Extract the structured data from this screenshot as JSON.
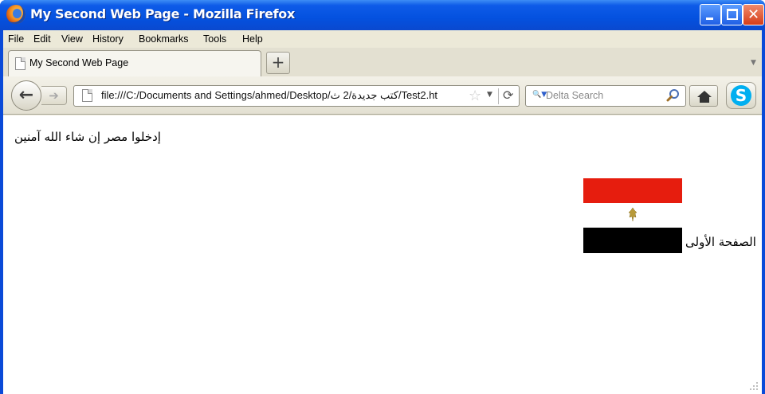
{
  "window": {
    "title": "My Second Web Page - Mozilla Firefox"
  },
  "menu": {
    "items": [
      {
        "label": "File"
      },
      {
        "label": "Edit"
      },
      {
        "label": "View"
      },
      {
        "label": "History"
      },
      {
        "label": "Bookmarks"
      },
      {
        "label": "Tools"
      },
      {
        "label": "Help"
      }
    ]
  },
  "tabs": {
    "active_label": "My Second Web Page",
    "new_tab_label": "+"
  },
  "navigation": {
    "url": "file:///C:/Documents and Settings/ahmed/Desktop/كتب جديدة/2 ث/Test2.ht",
    "search_placeholder": "Delta Search",
    "skype_letter": "S"
  },
  "page": {
    "heading_text": "إدخلوا مصر إن شاء الله آمنين",
    "link_text": "الصفحة الأولى",
    "flag_colors": {
      "red": "#e61d0e",
      "white": "#ffffff",
      "black": "#000000",
      "eagle": "#b89a3a"
    }
  },
  "icons": {
    "app": "firefox-logo-icon",
    "back": "back-arrow-icon",
    "forward": "forward-arrow-icon",
    "page": "page-icon",
    "bookmark": "star-icon",
    "reload": "reload-icon",
    "search": "magnifier-icon",
    "home": "home-icon",
    "skype": "skype-icon"
  }
}
